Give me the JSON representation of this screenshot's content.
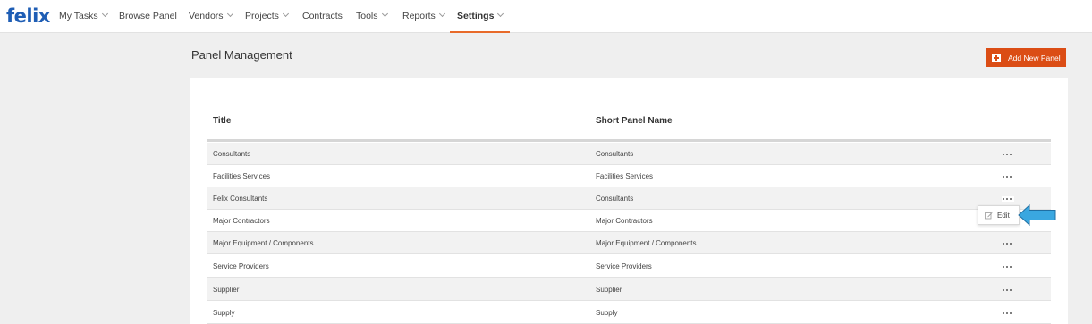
{
  "app": {
    "logo": "felix"
  },
  "nav": {
    "items": [
      {
        "label": "My Tasks",
        "dropdown": true,
        "active": false
      },
      {
        "label": "Browse Panel",
        "dropdown": false,
        "active": false
      },
      {
        "label": "Vendors",
        "dropdown": true,
        "active": false
      },
      {
        "label": "Projects",
        "dropdown": true,
        "active": false
      },
      {
        "label": "Contracts",
        "dropdown": false,
        "active": false
      },
      {
        "label": "Tools",
        "dropdown": true,
        "active": false
      },
      {
        "label": "Reports",
        "dropdown": true,
        "active": false
      },
      {
        "label": "Settings",
        "dropdown": true,
        "active": true
      }
    ]
  },
  "page": {
    "title": "Panel Management",
    "add_button_label": "Add New Panel"
  },
  "table": {
    "columns": [
      "Title",
      "Short Panel Name"
    ],
    "rows": [
      {
        "title": "Consultants",
        "short_name": "Consultants"
      },
      {
        "title": "Facilities Services",
        "short_name": "Facilities Services"
      },
      {
        "title": "Felix Consultants",
        "short_name": "Consultants"
      },
      {
        "title": "Major Contractors",
        "short_name": "Major Contractors"
      },
      {
        "title": "Major Equipment / Components",
        "short_name": "Major Equipment / Components"
      },
      {
        "title": "Service Providers",
        "short_name": "Service Providers"
      },
      {
        "title": "Supplier",
        "short_name": "Supplier"
      },
      {
        "title": "Supply",
        "short_name": "Supply"
      }
    ]
  },
  "row_menu": {
    "edit_label": "Edit"
  },
  "colors": {
    "brand_blue": "#1f5eb5",
    "accent_orange": "#db4d15",
    "active_tab_underline": "#e86a2a",
    "callout_arrow": "#3aa7e0"
  },
  "icons": {
    "row_actions": "more-dots-icon",
    "edit": "pencil-square-icon",
    "add": "plus-square-icon"
  }
}
